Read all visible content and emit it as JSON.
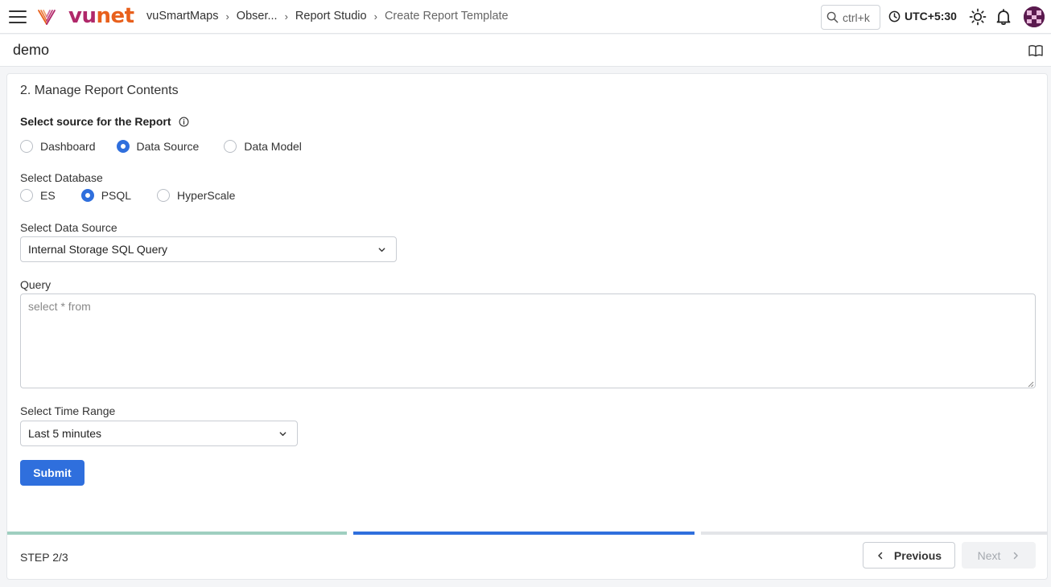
{
  "topbar": {
    "logo_part1": "vu",
    "logo_part2": "net",
    "breadcrumbs": [
      "vuSmartMaps",
      "Obser...",
      "Report Studio",
      "Create Report Template"
    ],
    "search_hint": "ctrl+k",
    "timezone": "UTC+5:30",
    "icons": [
      "menu-icon",
      "vunet-logo-icon",
      "search-icon",
      "clock-icon",
      "sun-icon",
      "bell-icon",
      "avatar"
    ]
  },
  "page": {
    "title": "demo",
    "help_icon": "book-icon"
  },
  "form": {
    "section_title": "2. Manage Report Contents",
    "source_label": "Select source for the Report",
    "source_options": [
      {
        "label": "Dashboard",
        "checked": false
      },
      {
        "label": "Data Source",
        "checked": true
      },
      {
        "label": "Data Model",
        "checked": false
      }
    ],
    "database_label": "Select Database",
    "database_options": [
      {
        "label": "ES",
        "checked": false
      },
      {
        "label": "PSQL",
        "checked": true
      },
      {
        "label": "HyperScale",
        "checked": false
      }
    ],
    "datasource_label": "Select Data Source",
    "datasource_value": "Internal Storage SQL Query",
    "query_label": "Query",
    "query_placeholder": "select * from",
    "query_value": "",
    "timerange_label": "Select Time Range",
    "timerange_value": "Last 5 minutes",
    "submit_label": "Submit"
  },
  "stepper": {
    "step_text": "STEP 2/3",
    "current_step": 2,
    "total_steps": 3,
    "colors": {
      "done": "#9fcfc0",
      "active": "#2f6fdd",
      "pending": "#e3e5e8"
    },
    "prev_label": "Previous",
    "next_label": "Next"
  }
}
